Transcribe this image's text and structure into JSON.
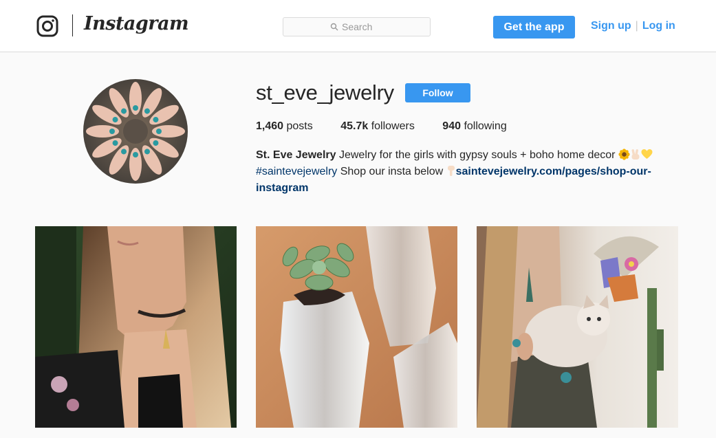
{
  "header": {
    "brand_wordmark": "Instagram",
    "search_placeholder": "Search",
    "get_app_label": "Get the app",
    "signup_label": "Sign up",
    "login_label": "Log in",
    "divider": "|"
  },
  "profile": {
    "username": "st_eve_jewelry",
    "follow_label": "Follow",
    "stats": {
      "posts_count": "1,460",
      "posts_label": "posts",
      "followers_count": "45.7k",
      "followers_label": "followers",
      "following_count": "940",
      "following_label": "following"
    },
    "bio": {
      "name": "St. Eve Jewelry",
      "text1": " Jewelry for the girls with gypsy souls + boho home decor ",
      "hashtag": "#saintevejewelry",
      "text2": " Shop our insta below ",
      "website": "saintevejewelry.com/pages/shop-our-instagram"
    }
  },
  "posts": [
    {
      "subject": "woman-choker-necklace-photo"
    },
    {
      "subject": "succulent-crystal-planter-photo"
    },
    {
      "subject": "woman-holding-cat-photo"
    }
  ],
  "colors": {
    "accent": "#3897f0",
    "link_dark": "#003569",
    "text": "#262626",
    "background": "#fafafa",
    "border": "#dbdbdb"
  }
}
